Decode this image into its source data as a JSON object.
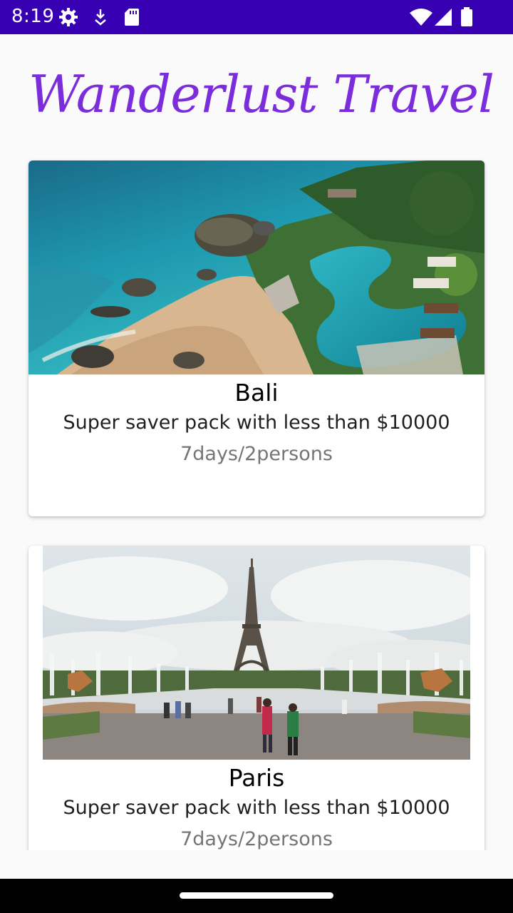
{
  "status_bar": {
    "time": "8:19",
    "left_icons": [
      "settings-gear-icon",
      "download-notification-icon",
      "sd-card-icon"
    ],
    "right_icons": [
      "wifi-icon",
      "cell-signal-icon",
      "battery-icon"
    ],
    "background": "#3700b3"
  },
  "app": {
    "title": "Wanderlust Travel",
    "title_color": "#7b2ddb"
  },
  "destinations": [
    {
      "name": "Bali",
      "description": "Super saver pack with less than $10000",
      "duration": "7days/2persons",
      "image": "bali-coast-photo"
    },
    {
      "name": "Paris",
      "description": "Super saver pack with less than $10000",
      "duration": "7days/2persons",
      "image": "eiffel-tower-photo"
    }
  ]
}
